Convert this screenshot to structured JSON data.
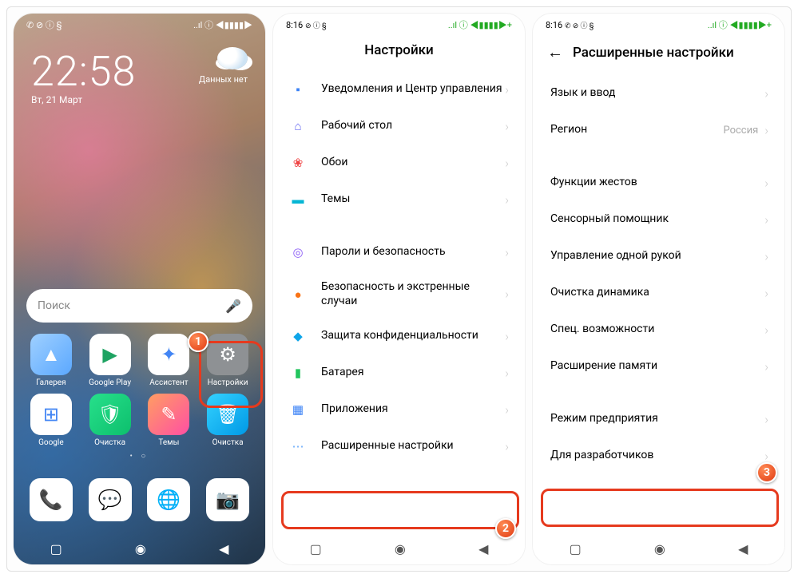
{
  "screen1": {
    "status_left": "✆ ⊘ ⓘ §",
    "status_right": "..ıl ⓘ ◀▮▮▮▮▶",
    "time": "22:58",
    "date": "Вт, 21 Март",
    "weather_text": "Данных нет",
    "search_placeholder": "Поиск",
    "apps": [
      {
        "label": "Галерея",
        "bg": "linear-gradient(135deg,#9fd0ff,#5ba8ff)",
        "glyph": "▲"
      },
      {
        "label": "Google Play",
        "bg": "#fff",
        "glyph": "▶",
        "fg": "#1ea362"
      },
      {
        "label": "Ассистент",
        "bg": "#fff",
        "glyph": "✦",
        "fg": "#4285f4"
      },
      {
        "label": "Настройки",
        "bg": "#8e9194",
        "glyph": "⚙"
      },
      {
        "label": "Google",
        "bg": "#fff",
        "glyph": "⊞",
        "fg": "#4285f4"
      },
      {
        "label": "Очистка",
        "bg": "linear-gradient(135deg,#27e08b,#0dbf6d)",
        "glyph": "🛡"
      },
      {
        "label": "Темы",
        "bg": "linear-gradient(135deg,#ff9e62,#ff4fa3)",
        "glyph": "✎"
      },
      {
        "label": "Очистка",
        "bg": "linear-gradient(135deg,#34d2ff,#0099e6)",
        "glyph": "🗑"
      }
    ],
    "dock": [
      {
        "bg": "#fff",
        "glyph": "📞",
        "fg": "#2d7ff9"
      },
      {
        "bg": "#fff",
        "glyph": "💬",
        "fg": "#2d7ff9"
      },
      {
        "bg": "#fff",
        "glyph": "🌐",
        "fg": "#e2483d"
      },
      {
        "bg": "#fff",
        "glyph": "📷",
        "fg": "#555"
      }
    ],
    "nav": {
      "recent": "▢",
      "home": "◉",
      "back": "◀"
    },
    "badge": "1"
  },
  "screen2": {
    "status_time": "8:16",
    "status_left_icons": "⊘ ⓘ §",
    "status_right": "..ıl ⓘ ◀▮▮▮▮▶+",
    "title": "Настройки",
    "items": [
      {
        "icon_bg": "#3b82f6",
        "glyph": "▪",
        "label": "Уведомления и Центр управления"
      },
      {
        "icon_bg": "#6366f1",
        "glyph": "⌂",
        "label": "Рабочий стол"
      },
      {
        "icon_bg": "#ef4444",
        "glyph": "❀",
        "label": "Обои"
      },
      {
        "icon_bg": "#06b6d4",
        "glyph": "▬",
        "label": "Темы"
      }
    ],
    "items2": [
      {
        "icon_bg": "#8b5cf6",
        "glyph": "◎",
        "label": "Пароли и безопасность"
      },
      {
        "icon_bg": "#f97316",
        "glyph": "●",
        "label": "Безопасность и экстренные случаи"
      },
      {
        "icon_bg": "#0ea5e9",
        "glyph": "◆",
        "label": "Защита конфиденциальности"
      },
      {
        "icon_bg": "#22c55e",
        "glyph": "▮",
        "label": "Батарея"
      },
      {
        "icon_bg": "#3b82f6",
        "glyph": "▦",
        "label": "Приложения"
      },
      {
        "icon_bg": "#60a5fa",
        "glyph": "⋯",
        "label": "Расширенные настройки"
      }
    ],
    "badge": "2"
  },
  "screen3": {
    "status_time": "8:16",
    "status_left_icons": "✆ ⊘ ⓘ §",
    "status_right": "..ıl ⓘ ◀▮▮▮▮▶+",
    "title": "Расширенные настройки",
    "group1": [
      {
        "label": "Язык и ввод",
        "value": ""
      },
      {
        "label": "Регион",
        "value": "Россия"
      }
    ],
    "group2": [
      {
        "label": "Функции жестов"
      },
      {
        "label": "Сенсорный помощник"
      },
      {
        "label": "Управление одной рукой"
      },
      {
        "label": "Очистка динамика"
      },
      {
        "label": "Спец. возможности"
      },
      {
        "label": "Расширение памяти"
      }
    ],
    "group3": [
      {
        "label": "Режим предприятия"
      },
      {
        "label": "Для разработчиков"
      }
    ],
    "badge": "3"
  }
}
